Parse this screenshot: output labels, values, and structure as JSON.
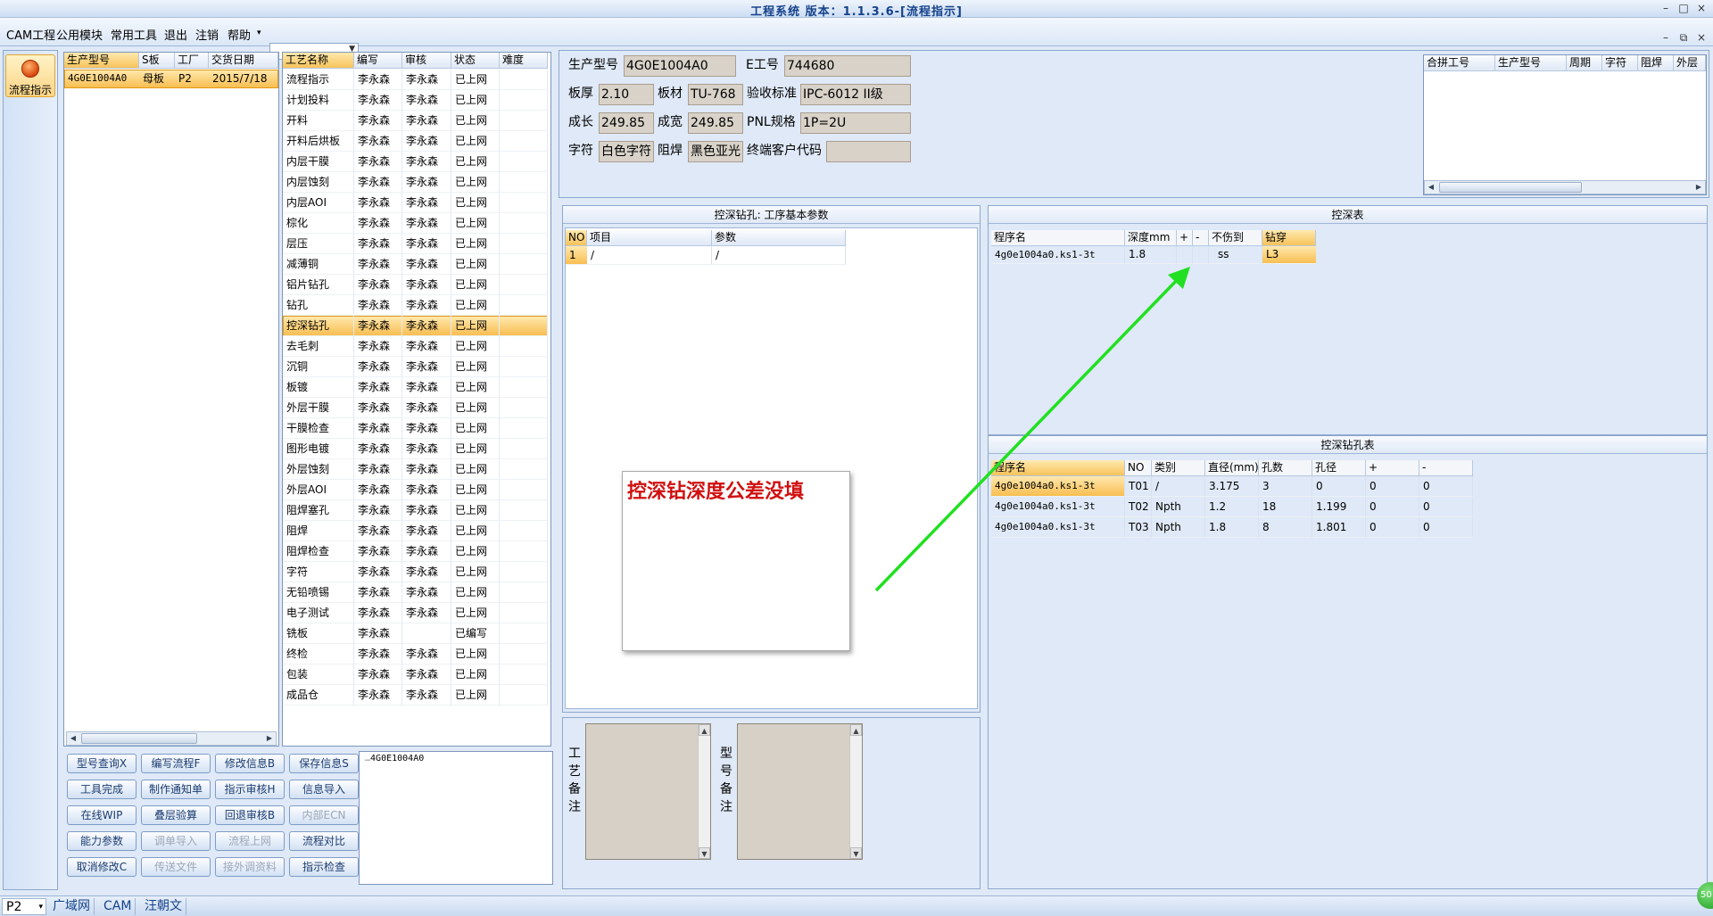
{
  "window": {
    "title": "工程系统 版本：1.1.3.6-[流程指示]",
    "btn_min": "–",
    "btn_max": "□",
    "btn_close": "×"
  },
  "menu": {
    "items": [
      "CAM工程",
      "公用模块",
      "常用工具",
      "退出",
      "注销",
      "帮助"
    ],
    "help_arrow": "▾",
    "combo_value": ""
  },
  "sidebar": {
    "flow_label": "流程指示"
  },
  "order_table": {
    "headers": [
      "生产型号",
      "S板",
      "工厂",
      "交货日期"
    ],
    "row": [
      "4G0E1004A0",
      "母板",
      "P2",
      "2015/7/18"
    ]
  },
  "process_table": {
    "headers": [
      "工艺名称",
      "编写",
      "审核",
      "状态",
      "难度"
    ],
    "rows": [
      [
        "流程指示",
        "李永森",
        "李永森",
        "已上网"
      ],
      [
        "计划投料",
        "李永森",
        "李永森",
        "已上网"
      ],
      [
        "开料",
        "李永森",
        "李永森",
        "已上网"
      ],
      [
        "开料后烘板",
        "李永森",
        "李永森",
        "已上网"
      ],
      [
        "内层干膜",
        "李永森",
        "李永森",
        "已上网"
      ],
      [
        "内层蚀刻",
        "李永森",
        "李永森",
        "已上网"
      ],
      [
        "内层AOI",
        "李永森",
        "李永森",
        "已上网"
      ],
      [
        "棕化",
        "李永森",
        "李永森",
        "已上网"
      ],
      [
        "层压",
        "李永森",
        "李永森",
        "已上网"
      ],
      [
        "减薄铜",
        "李永森",
        "李永森",
        "已上网"
      ],
      [
        "铝片钻孔",
        "李永森",
        "李永森",
        "已上网"
      ],
      [
        "钻孔",
        "李永森",
        "李永森",
        "已上网"
      ],
      [
        "控深钻孔",
        "李永森",
        "李永森",
        "已上网"
      ],
      [
        "去毛刺",
        "李永森",
        "李永森",
        "已上网"
      ],
      [
        "沉铜",
        "李永森",
        "李永森",
        "已上网"
      ],
      [
        "板镀",
        "李永森",
        "李永森",
        "已上网"
      ],
      [
        "外层干膜",
        "李永森",
        "李永森",
        "已上网"
      ],
      [
        "干膜检查",
        "李永森",
        "李永森",
        "已上网"
      ],
      [
        "图形电镀",
        "李永森",
        "李永森",
        "已上网"
      ],
      [
        "外层蚀刻",
        "李永森",
        "李永森",
        "已上网"
      ],
      [
        "外层AOI",
        "李永森",
        "李永森",
        "已上网"
      ],
      [
        "阻焊塞孔",
        "李永森",
        "李永森",
        "已上网"
      ],
      [
        "阻焊",
        "李永森",
        "李永森",
        "已上网"
      ],
      [
        "阻焊检查",
        "李永森",
        "李永森",
        "已上网"
      ],
      [
        "字符",
        "李永森",
        "李永森",
        "已上网"
      ],
      [
        "无铅喷锡",
        "李永森",
        "李永森",
        "已上网"
      ],
      [
        "电子测试",
        "李永森",
        "李永森",
        "已上网"
      ],
      [
        "铣板",
        "李永森",
        "",
        "已编写"
      ],
      [
        "终检",
        "李永森",
        "李永森",
        "已上网"
      ],
      [
        "包装",
        "李永森",
        "李永森",
        "已上网"
      ],
      [
        "成品仓",
        "李永森",
        "李永森",
        "已上网"
      ]
    ]
  },
  "buttons": [
    [
      "型号查询X",
      "编写流程F",
      "修改信息B",
      "保存信息S"
    ],
    [
      "工具完成",
      "制作通知单",
      "指示审核H",
      "信息导入"
    ],
    [
      "在线WIP",
      "叠层验算",
      "回退审核B",
      "内部ECN"
    ],
    [
      "能力参数",
      "调单导入",
      "流程上网",
      "流程对比"
    ],
    [
      "取消修改C",
      "传送文件",
      "接外调资料",
      "指示检查"
    ]
  ],
  "tree": {
    "node": "4G0E1004A0"
  },
  "info": {
    "prod_model_label": "生产型号",
    "prod_model": "4G0E1004A0",
    "e_no_label": "E工号",
    "e_no": "744680",
    "thickness_label": "板厚",
    "thickness": "2.10",
    "material_label": "板材",
    "material": "TU-768",
    "standard_label": "验收标准",
    "standard": "IPC-6012 II级",
    "len_label": "成长",
    "len": "249.85",
    "width_label": "成宽",
    "width": "249.85",
    "pnl_label": "PNL规格",
    "pnl": "1P=2U",
    "char_label": "字符",
    "char": "白色字符",
    "mask_label": "阻焊",
    "mask": "黑色亚光",
    "customer_label": "终端客户代码",
    "customer": ""
  },
  "merge_table": {
    "headers": [
      "合拼工号",
      "生产型号",
      "周期",
      "字符",
      "阻焊",
      "外层"
    ]
  },
  "param_group": {
    "title": "控深钻孔: 工序基本参数",
    "headers": [
      "NO",
      "项目",
      "参数"
    ],
    "row": [
      "1",
      "/",
      "/"
    ]
  },
  "depth_table": {
    "title": "控深表",
    "headers": [
      "程序名",
      "深度mm",
      "+",
      "-",
      "不伤到",
      "钻穿"
    ],
    "row": [
      "4g0e1004a0.ks1-3t",
      "1.8",
      "",
      "",
      "ss",
      "L3"
    ]
  },
  "hole_table": {
    "title": "控深钻孔表",
    "headers": [
      "程序名",
      "NO",
      "类别",
      "直径(mm)",
      "孔数",
      "孔径",
      "+",
      "-"
    ],
    "rows": [
      [
        "4g0e1004a0.ks1-3t",
        "T01",
        "/",
        "3.175",
        "3",
        "0",
        "0",
        "0"
      ],
      [
        "4g0e1004a0.ks1-3t",
        "T02",
        "Npth",
        "1.2",
        "18",
        "1.199",
        "0",
        "0"
      ],
      [
        "4g0e1004a0.ks1-3t",
        "T03",
        "Npth",
        "1.8",
        "8",
        "1.801",
        "0",
        "0"
      ]
    ]
  },
  "notes": {
    "craft_label": [
      "工",
      "艺",
      "备",
      "注"
    ],
    "model_label": [
      "型",
      "号",
      "备",
      "注"
    ]
  },
  "callout": {
    "text": "控深钻深度公差没填"
  },
  "status": {
    "items": [
      "P2",
      "广域网",
      "CAM",
      "汪朝文"
    ],
    "combo_arrow": "▾",
    "badge": "50"
  },
  "colors": {
    "accent_selected": "#f8be52",
    "annotation_arrow": "#21e021",
    "annotation_text": "#d01010"
  }
}
